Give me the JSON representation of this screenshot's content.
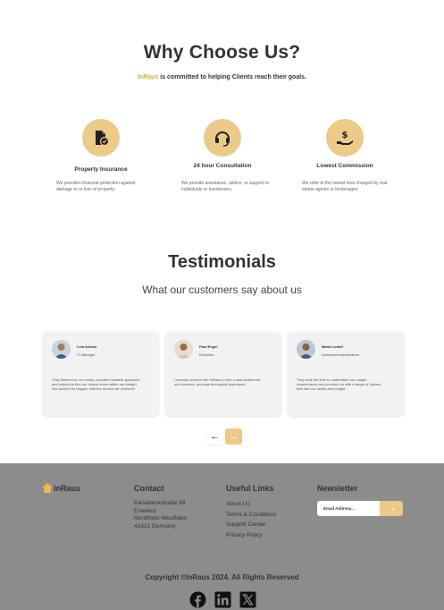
{
  "why": {
    "title": "Why Choose Us?",
    "subtitle_brand": "InRaus",
    "subtitle_rest": " is committed to helping Clients reach their goals.",
    "features": [
      {
        "icon": "document-shield-icon",
        "title": "Property Insurance",
        "desc": "We provides financial protection against damage to or loss of property."
      },
      {
        "icon": "headset-icon",
        "title": "24 hour Consultation",
        "desc": "We provide assistance, advice, or support to individuals or businesses."
      },
      {
        "icon": "hand-dollar-icon",
        "title": "Lowest Commission",
        "desc": "We refer to the lowest fees charged by real estate agents or brokerages."
      }
    ]
  },
  "testimonials": {
    "title": "Testimonials",
    "subtitle": "What our customers say about us",
    "cards": [
      {
        "name": "Leia Achotz",
        "role": "IT Manager",
        "quote": "They listened to our needs, provided valuable guidance, and helped us find our dream home within our budget. We couldn't be happier with the service we received!"
      },
      {
        "name": "Paul Engel",
        "role": "Elektriker",
        "quote": "I recently worked with InRaus to find a new location for our business, and was thoroughly impressed..."
      },
      {
        "name": "Maria Ludolf",
        "role": "Anlasschirmausstellerin",
        "quote": "They took the time to understand our unique requirements and provided us with a range of options that met our needs and budget."
      }
    ],
    "prev_label": "←",
    "next_label": "→"
  },
  "footer": {
    "logo_text": "InRaus",
    "contact_title": "Contact",
    "contact_lines": [
      "Kiesebeckstraße 68",
      "Erkelenz",
      "Nordrhein-Westfalen",
      "41812 Germany"
    ],
    "links_title": "Useful Links",
    "links": [
      "About Us",
      "Terms & Conditions",
      "Support Center",
      "Privacy Policy"
    ],
    "newsletter_title": "Newsletter",
    "newsletter_placeholder": "Email Address...",
    "newsletter_button": "→",
    "copyright": "Copyright ©InRaus 2024. All Rights Reserved",
    "socials": [
      "facebook-icon",
      "linkedin-icon",
      "x-icon"
    ]
  },
  "colors": {
    "accent": "#edc986",
    "brand_text": "#d9a93a",
    "footer_bg": "#8c8c8c"
  }
}
